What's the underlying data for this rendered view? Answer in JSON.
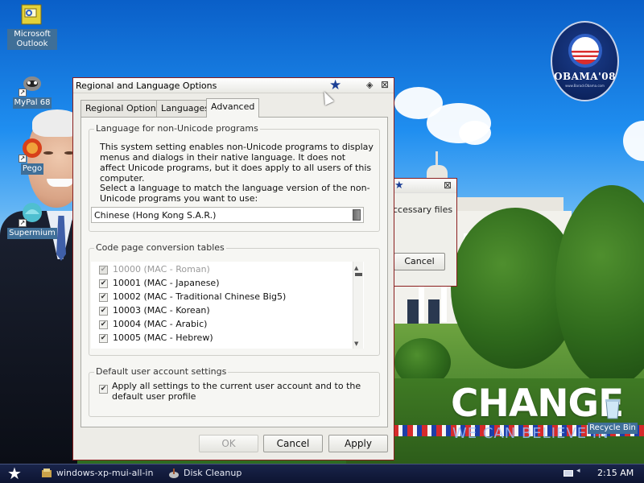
{
  "desktop": {
    "icons": [
      {
        "label": "Microsoft Outlook",
        "icon": "outlook-icon"
      },
      {
        "label": "MyPal 68",
        "icon": "mypal-icon"
      },
      {
        "label": "Pego",
        "icon": "pego-icon"
      },
      {
        "label": "Supermium",
        "icon": "supermium-icon"
      },
      {
        "label": "Recycle Bin",
        "icon": "recycle-bin-icon"
      }
    ],
    "wallpaper": {
      "logo_name": "OBAMA'08",
      "logo_url": "www.BarackObama.com",
      "headline": "CHANGE",
      "tagline": "WE CAN BELIEVE IN"
    }
  },
  "background_dialog": {
    "message_fragment": "ccessary files",
    "cancel_label": "Cancel"
  },
  "dialog": {
    "title": "Regional and Language Options",
    "tabs": [
      {
        "label": "Regional Options",
        "active": false
      },
      {
        "label": "Languages",
        "active": false
      },
      {
        "label": "Advanced",
        "active": true
      }
    ],
    "non_unicode": {
      "group_title": "Language for non-Unicode programs",
      "description": "This system setting enables non-Unicode programs to display menus and dialogs in their native language. It does not affect Unicode programs, but it does apply to all users of this computer.",
      "prompt": "Select a language to match the language version of the non-Unicode programs you want to use:",
      "selected_language": "Chinese (Hong Kong S.A.R.)"
    },
    "code_pages": {
      "group_title": "Code page conversion tables",
      "items": [
        {
          "label": "10000 (MAC - Roman)",
          "checked": true,
          "disabled": true
        },
        {
          "label": "10001 (MAC - Japanese)",
          "checked": true,
          "disabled": false
        },
        {
          "label": "10002 (MAC - Traditional Chinese Big5)",
          "checked": true,
          "disabled": false
        },
        {
          "label": "10003 (MAC - Korean)",
          "checked": true,
          "disabled": false
        },
        {
          "label": "10004 (MAC - Arabic)",
          "checked": true,
          "disabled": false
        },
        {
          "label": "10005 (MAC - Hebrew)",
          "checked": true,
          "disabled": false
        }
      ]
    },
    "default_user": {
      "group_title": "Default user account settings",
      "checkbox_label": "Apply all settings to the current user account and to the default user profile",
      "checked": true
    },
    "buttons": {
      "ok": "OK",
      "cancel": "Cancel",
      "apply": "Apply"
    }
  },
  "taskbar": {
    "tasks": [
      {
        "label": "windows-xp-mui-all-in",
        "icon": "installer-icon"
      },
      {
        "label": "Disk Cleanup",
        "icon": "disk-cleanup-icon"
      }
    ],
    "clock": "2:15 AM"
  },
  "colors": {
    "dialog_border": "#8a1e1e",
    "taskbar": "#0d1431",
    "accent_star": "#1c3f95"
  }
}
